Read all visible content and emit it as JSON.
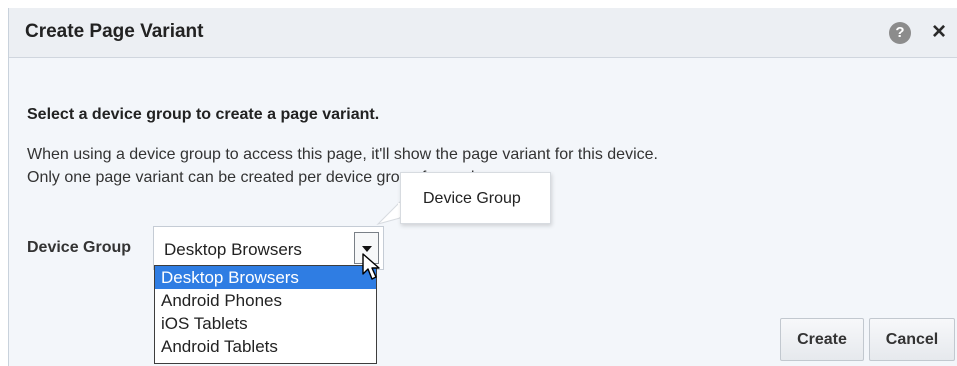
{
  "dialog": {
    "title": "Create Page Variant",
    "help_icon": "question-circle-icon",
    "help_glyph": "?",
    "close_icon": "close-icon",
    "close_glyph": "×"
  },
  "body": {
    "heading": "Select a device group to create a page variant.",
    "description_line1": "When using a device group to access this page, it'll show the page variant for this device.",
    "description_line2": "Only one page variant can be created per device group for each page."
  },
  "device_group": {
    "label": "Device Group",
    "selected": "Desktop Browsers",
    "options": [
      "Desktop Browsers",
      "Android Phones",
      "iOS Tablets",
      "Android Tablets"
    ],
    "tooltip": "Device Group"
  },
  "buttons": {
    "create": "Create",
    "cancel": "Cancel"
  },
  "colors": {
    "selected_option": "#2f7de3",
    "dialog_background": "#f3f6fa"
  }
}
